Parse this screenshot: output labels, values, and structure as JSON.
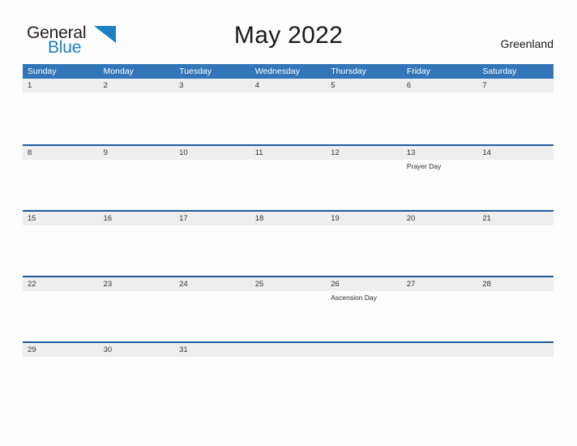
{
  "brand": {
    "name_part1": "General",
    "name_part2": "Blue",
    "flag_icon": "blue-triangle-flag-icon",
    "accent_color": "#1d7fc3",
    "text_color": "#231f20"
  },
  "header": {
    "title": "May 2022",
    "country": "Greenland"
  },
  "theme": {
    "header_blue": "#3275b8",
    "row_separator_blue": "#1f5c9e",
    "date_band_gray": "#eeeeee",
    "page_background": "#fdfdfd"
  },
  "calendar": {
    "month": "May",
    "year": "2022",
    "weekday_headers": [
      "Sunday",
      "Monday",
      "Tuesday",
      "Wednesday",
      "Thursday",
      "Friday",
      "Saturday"
    ],
    "weeks": [
      {
        "days": [
          {
            "date": "1",
            "event": ""
          },
          {
            "date": "2",
            "event": ""
          },
          {
            "date": "3",
            "event": ""
          },
          {
            "date": "4",
            "event": ""
          },
          {
            "date": "5",
            "event": ""
          },
          {
            "date": "6",
            "event": ""
          },
          {
            "date": "7",
            "event": ""
          }
        ]
      },
      {
        "days": [
          {
            "date": "8",
            "event": ""
          },
          {
            "date": "9",
            "event": ""
          },
          {
            "date": "10",
            "event": ""
          },
          {
            "date": "11",
            "event": ""
          },
          {
            "date": "12",
            "event": ""
          },
          {
            "date": "13",
            "event": "Prayer Day"
          },
          {
            "date": "14",
            "event": ""
          }
        ]
      },
      {
        "days": [
          {
            "date": "15",
            "event": ""
          },
          {
            "date": "16",
            "event": ""
          },
          {
            "date": "17",
            "event": ""
          },
          {
            "date": "18",
            "event": ""
          },
          {
            "date": "19",
            "event": ""
          },
          {
            "date": "20",
            "event": ""
          },
          {
            "date": "21",
            "event": ""
          }
        ]
      },
      {
        "days": [
          {
            "date": "22",
            "event": ""
          },
          {
            "date": "23",
            "event": ""
          },
          {
            "date": "24",
            "event": ""
          },
          {
            "date": "25",
            "event": ""
          },
          {
            "date": "26",
            "event": "Ascension Day"
          },
          {
            "date": "27",
            "event": ""
          },
          {
            "date": "28",
            "event": ""
          }
        ]
      },
      {
        "days": [
          {
            "date": "29",
            "event": ""
          },
          {
            "date": "30",
            "event": ""
          },
          {
            "date": "31",
            "event": ""
          },
          {
            "date": "",
            "event": ""
          },
          {
            "date": "",
            "event": ""
          },
          {
            "date": "",
            "event": ""
          },
          {
            "date": "",
            "event": ""
          }
        ]
      }
    ]
  }
}
